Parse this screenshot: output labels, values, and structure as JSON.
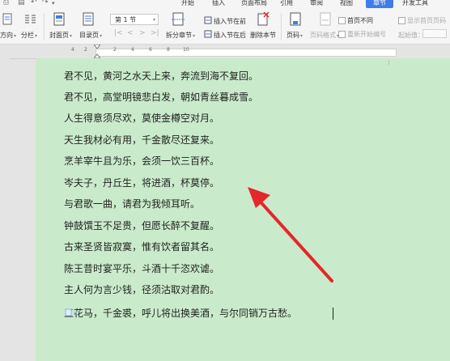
{
  "menu_tabs": [
    "开始",
    "插入",
    "页面布局",
    "引用",
    "审阅",
    "视图",
    "章节",
    "开发工具"
  ],
  "active_tab": "章节",
  "ribbon": {
    "direction": "方向",
    "columns": "分栏",
    "cover": "封面页",
    "toc": "目录页",
    "section_select": "第 1 节",
    "split_chapter": "拆分章节",
    "insert_section_before": "插入节在前",
    "insert_section_after": "插入节在后",
    "delete_section": "删除本节",
    "page_number": "页码",
    "page_number_format": "页码格式",
    "first_page_diff": "首页不同",
    "restart_numbering": "重新开始编号",
    "show_first_page_number": "显示首页页码",
    "start_at_label": "起始值："
  },
  "ruler_ticks": [
    "4",
    "2",
    "2",
    "4",
    "6",
    "8",
    "10"
  ],
  "document": {
    "lines": [
      "君不见，黄河之水天上来，奔流到海不复回。",
      "君不见，高堂明镜悲白发，朝如青丝暮成雪。",
      "人生得意须尽欢，莫使金樽空对月。",
      "天生我材必有用，千金散尽还复来。",
      "烹羊宰牛且为乐，会须一饮三百杯。",
      "岑夫子，丹丘生，将进酒，杯莫停。",
      "与君歌一曲，请君为我倾耳听。",
      "钟鼓馔玉不足贵，但愿长醉不复醒。",
      "古来圣贤皆寂寞，惟有饮者留其名。",
      "陈王昔时宴平乐，斗酒十千恣欢谑。",
      "主人何为言少钱，径须沽取对君酌。",
      "五花马，千金裘，呼儿将出换美酒，与尔同销万古愁。"
    ]
  },
  "colors": {
    "page_bg": "#c9ebcb",
    "accent": "#3f7de8",
    "arrow": "#e5262b"
  }
}
